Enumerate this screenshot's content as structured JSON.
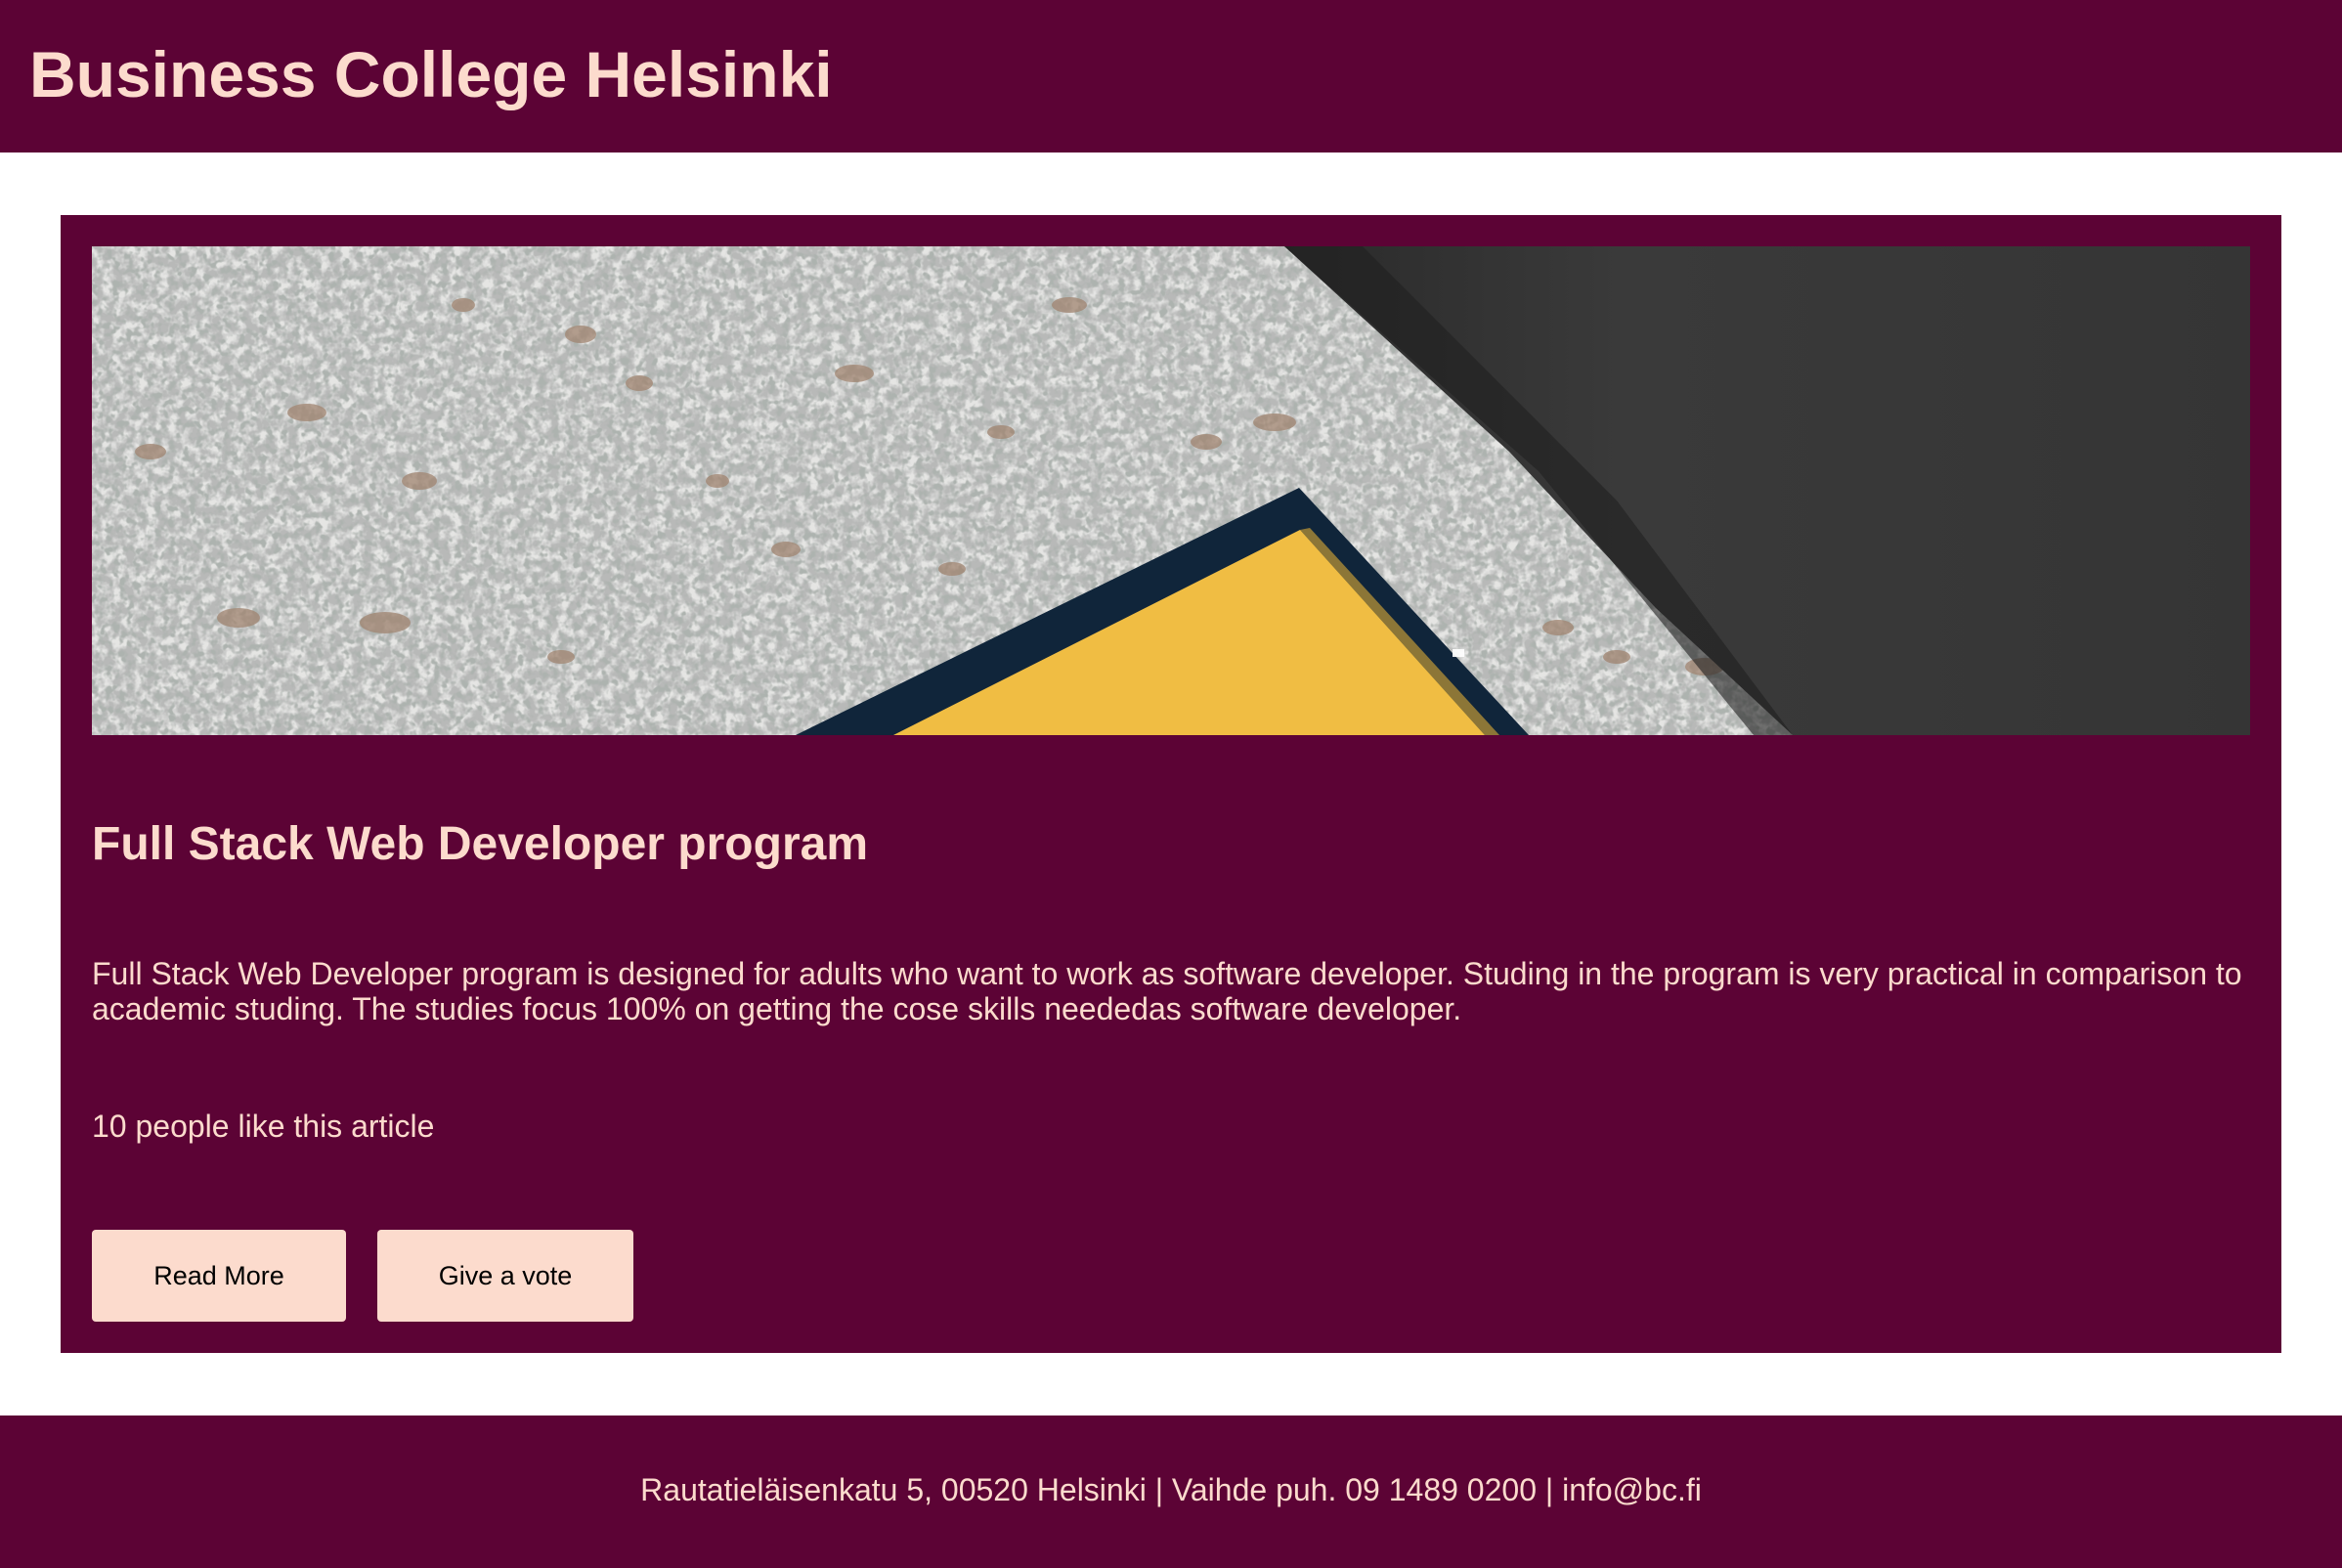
{
  "header": {
    "title": "Business College Helsinki"
  },
  "article": {
    "image_icon": "photo-terrazzo-yellow-paper",
    "title": "Full Stack Web Developer program",
    "description": "Full Stack Web Developer program is designed for adults who want to work as software developer. Studing in the program is very practical in comparison to academic studing. The studies focus 100% on getting the cose skills neededas software developer.",
    "likes_text": "10 people like this article",
    "read_more_label": "Read More",
    "vote_label": "Give a vote"
  },
  "footer": {
    "contact_text": "Rautatieläisenkatu 5, 00520 Helsinki | Vaihde puh. 09 1489 0200 | info@bc.fi"
  },
  "colors": {
    "brand": "#5c0335",
    "accent": "#fcdbcd",
    "background": "#ffffff"
  }
}
